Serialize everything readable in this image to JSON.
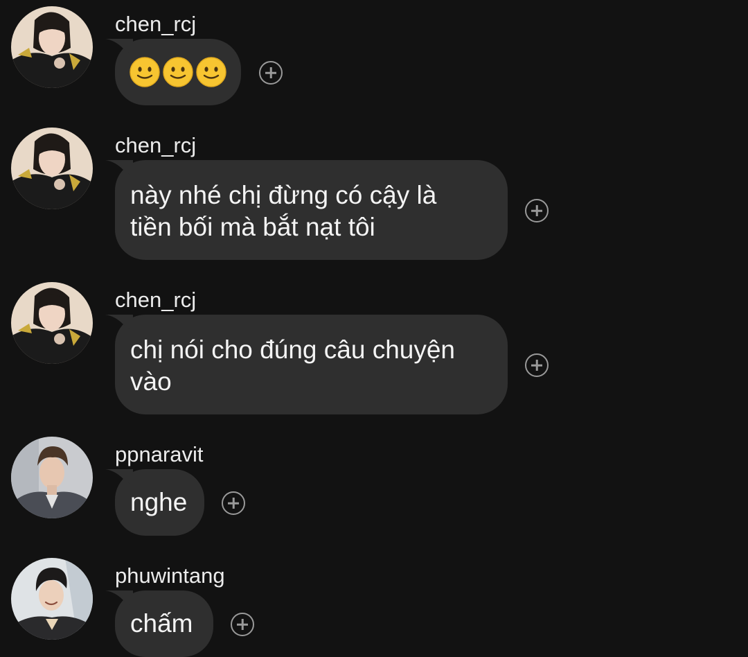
{
  "messages": [
    {
      "username": "chen_rcj",
      "kind": "emoji",
      "emoji": [
        "slightly-smiling-face",
        "slightly-smiling-face",
        "slightly-smiling-face"
      ],
      "react_icon": "add-reaction-icon"
    },
    {
      "username": "chen_rcj",
      "kind": "text",
      "lines": [
        "này nhé chị đừng có cậy là",
        "tiền bối mà bắt nạt tôi"
      ],
      "react_icon": "add-reaction-icon"
    },
    {
      "username": "chen_rcj",
      "kind": "text",
      "lines": [
        "chị nói cho đúng câu chuyện",
        "vào"
      ],
      "react_icon": "add-reaction-icon"
    },
    {
      "username": "ppnaravit",
      "kind": "text",
      "lines": [
        "nghe"
      ],
      "react_icon": "add-reaction-icon"
    },
    {
      "username": "phuwintang",
      "kind": "text",
      "lines": [
        "chấm"
      ],
      "react_icon": "add-reaction-icon"
    }
  ],
  "colors": {
    "background": "#121212",
    "bubble": "#2f2f2f",
    "text": "#f4f4f4",
    "username": "#ececec",
    "react_icon": "#9a9a9a",
    "emoji_face": "#f7c531"
  }
}
